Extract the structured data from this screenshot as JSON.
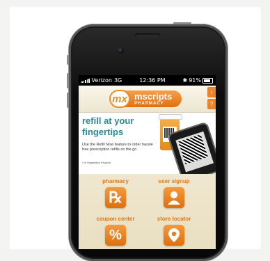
{
  "status": {
    "carrier": "Verizon",
    "network": "3G",
    "time": "12:36 PM",
    "battery": "91%"
  },
  "header": {
    "logo_mark": "mx",
    "brand": "mscripts",
    "sub": "PHARMACY",
    "tab_info": "i",
    "tab_help": "?"
  },
  "promo": {
    "title_line1": "refill at your",
    "title_line2": "fingertips",
    "text": "Use the Refill Now feature to order hassle free prescription refills on the go",
    "note": "* for Registration Required"
  },
  "menu": {
    "pharmacy": {
      "label": "pharmacy",
      "glyph": "℞",
      "icon": "rx-icon"
    },
    "signup": {
      "label": "user signup",
      "icon": "user-icon"
    },
    "coupon": {
      "label": "coupon center",
      "glyph": "%",
      "icon": "percent-icon"
    },
    "store": {
      "label": "store locator",
      "icon": "location-pin-icon"
    }
  },
  "colors": {
    "accent": "#e9842a",
    "promo_title": "#2d8a95",
    "screen_bg": "#f7f2e6"
  }
}
